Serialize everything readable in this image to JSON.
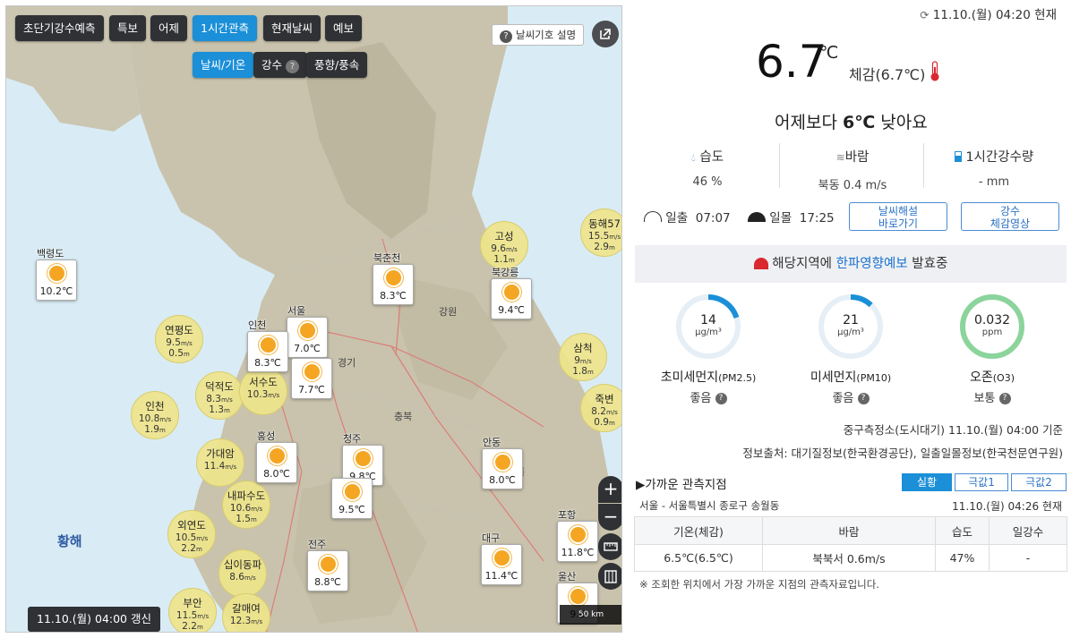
{
  "map": {
    "top_buttons": [
      "초단기강수예측",
      "특보",
      "어제",
      "1시간관측",
      "현재날씨",
      "예보"
    ],
    "active_top": "1시간관측",
    "sub_buttons": [
      "날씨/기온",
      "강수",
      "풍향/풍속"
    ],
    "active_sub": "날씨/기온",
    "legend_button": "날씨기호 설명",
    "updated": "11.10.(월) 04:00 갱신",
    "scale": "50 km",
    "sea_label": "황해",
    "zoom_in": "+",
    "zoom_out": "−",
    "stations": [
      {
        "name": "백령도",
        "temp": "10.2℃"
      },
      {
        "name": "서울",
        "temp": "7.0℃"
      },
      {
        "name": "인천",
        "temp": "8.3℃"
      },
      {
        "name": "북춘천",
        "temp": "8.3℃"
      },
      {
        "name": "북강릉",
        "temp": "9.4℃"
      },
      {
        "name": "",
        "temp": "7.7℃"
      },
      {
        "name": "홍성",
        "temp": "8.0℃"
      },
      {
        "name": "청주",
        "temp": "9.8℃"
      },
      {
        "name": "",
        "temp": "9.5℃"
      },
      {
        "name": "안동",
        "temp": "8.0℃"
      },
      {
        "name": "포항",
        "temp": "11.8℃"
      },
      {
        "name": "대구",
        "temp": "11.4℃"
      },
      {
        "name": "전주",
        "temp": "8.8℃"
      },
      {
        "name": "울산",
        "temp": "9.6"
      }
    ],
    "wind": [
      {
        "name": "고성",
        "speed": "9.6",
        "unit": "m/s",
        "wave": "1.1"
      },
      {
        "name": "동해57",
        "speed": "15.5",
        "unit": "m/s",
        "wave": "2.9"
      },
      {
        "name": "연평도",
        "speed": "9.5",
        "unit": "m/s",
        "wave": "0.5"
      },
      {
        "name": "삼척",
        "speed": "9",
        "unit": "m/s",
        "wave": "1.8"
      },
      {
        "name": "덕적도",
        "speed": "8.3",
        "unit": "m/s",
        "wave": "1.3"
      },
      {
        "name": "서수도",
        "speed": "10.3",
        "unit": "m/s",
        "wave": ""
      },
      {
        "name": "인천",
        "speed": "10.8",
        "unit": "m/s",
        "wave": "1.9"
      },
      {
        "name": "죽변",
        "speed": "8.2",
        "unit": "m/s",
        "wave": "0.9"
      },
      {
        "name": "가대암",
        "speed": "11.4",
        "unit": "m/s",
        "wave": ""
      },
      {
        "name": "내파수도",
        "speed": "10.6",
        "unit": "m/s",
        "wave": "1.5"
      },
      {
        "name": "외연도",
        "speed": "10.5",
        "unit": "m/s",
        "wave": "2.2"
      },
      {
        "name": "십이동파",
        "speed": "8.6",
        "unit": "m/s",
        "wave": ""
      },
      {
        "name": "부안",
        "speed": "11.5",
        "unit": "m/s",
        "wave": "2.2"
      },
      {
        "name": "갈매여",
        "speed": "12.3",
        "unit": "m/s",
        "wave": ""
      }
    ],
    "region_labels": [
      "경기",
      "강원",
      "충북",
      "북"
    ]
  },
  "panel": {
    "time_now": "11.10.(월) 04:20 현재",
    "temp": "6.7",
    "temp_unit": "℃",
    "feels": "체감(6.7℃)",
    "compare_pre": "어제보다 ",
    "compare_val": "6℃",
    "compare_post": " 낮아요",
    "humidity_label": "습도",
    "humidity_val": "46 %",
    "wind_label": "바람",
    "wind_val": "북동 0.4 m/s",
    "rain_label": "1시간강수량",
    "rain_val": "- mm",
    "sunrise_label": "일출",
    "sunrise_time": "07:07",
    "sunset_label": "일몰",
    "sunset_time": "17:25",
    "btn_explain_1": "날씨해설",
    "btn_explain_2": "바로가기",
    "btn_video_1": "강수",
    "btn_video_2": "체감영상",
    "alert_pre": "해당지역에 ",
    "alert_hl": "한파영향예보",
    "alert_post": " 발효중",
    "pm25": {
      "value": "14",
      "unit": "µg/m³",
      "name": "초미세먼지",
      "code": "(PM2.5)",
      "grade": "좋음",
      "fill": 0.2
    },
    "pm10": {
      "value": "21",
      "unit": "µg/m³",
      "name": "미세먼지",
      "code": "(PM10)",
      "grade": "좋음",
      "fill": 0.12
    },
    "o3": {
      "value": "0.032",
      "unit": "ppm",
      "name": "오존",
      "code": "(O3)",
      "grade": "보통",
      "fill": 1.0
    },
    "source1": "중구측정소(도시대기) 11.10.(월) 04:00 기준",
    "source2": "정보출처: 대기질정보(한국환경공단), 일출일몰정보(한국천문연구원)",
    "near_title": "▶가까운 관측지점",
    "tabs": [
      "실황",
      "극값1",
      "극값2"
    ],
    "location": "서울 - 서울특별시 종로구 송월동",
    "location_time": "11.10.(월) 04:26 현재",
    "table_headers": [
      "기온(체감)",
      "바람",
      "습도",
      "일강수"
    ],
    "table_row": [
      "6.5℃(6.5℃)",
      "북북서 0.6m/s",
      "47%",
      "-"
    ],
    "note": "※ 조회한 위치에서 가장 가까운 지점의 관측자료입니다."
  },
  "colors": {
    "accent": "#1b8fd8",
    "alert_red": "#d9282f",
    "ring_blue": "#1b8fd8",
    "ring_green": "#8bd49b"
  }
}
